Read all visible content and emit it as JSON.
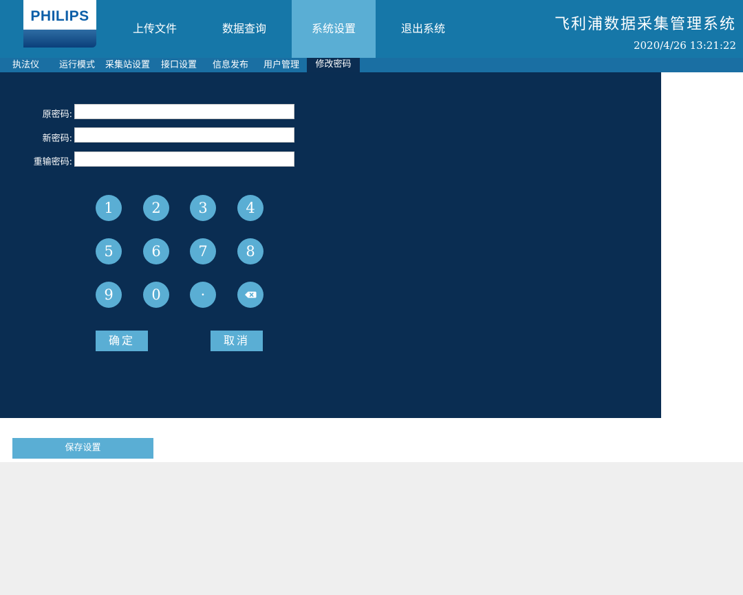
{
  "header": {
    "logo_text": "PHILIPS",
    "nav": [
      {
        "label": "上传文件"
      },
      {
        "label": "数据查询"
      },
      {
        "label": "系统设置"
      },
      {
        "label": "退出系统"
      }
    ],
    "app_title": "飞利浦数据采集管理系统",
    "datetime": "2020/4/26 13:21:22"
  },
  "subnav": {
    "items": [
      {
        "label": "执法仪"
      },
      {
        "label": "运行模式"
      },
      {
        "label": "采集站设置"
      },
      {
        "label": "接口设置"
      },
      {
        "label": "信息发布"
      },
      {
        "label": "用户管理"
      },
      {
        "label": "修改密码"
      }
    ],
    "active": "修改密码"
  },
  "form": {
    "old_password_label": "原密码:",
    "old_password_value": "",
    "new_password_label": "新密码:",
    "new_password_value": "",
    "repeat_password_label": "重输密码:",
    "repeat_password_value": ""
  },
  "keypad": {
    "keys": [
      "1",
      "2",
      "3",
      "4",
      "5",
      "6",
      "7",
      "8",
      "9",
      "0",
      "·"
    ],
    "backspace_icon": "backspace-icon"
  },
  "actions": {
    "confirm_label": "确定",
    "cancel_label": "取消",
    "save_label": "保存设置"
  },
  "colors": {
    "header_bg": "#1677a8",
    "active_nav": "#5aaed4",
    "panel_bg": "#0a2d52",
    "button_bg": "#5aaed4"
  }
}
